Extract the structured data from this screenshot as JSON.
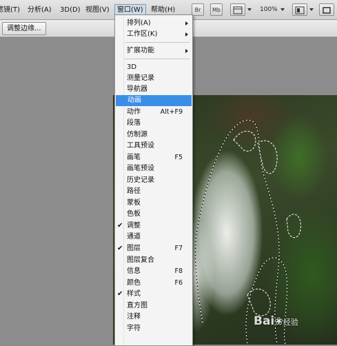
{
  "menubar": {
    "items": [
      {
        "label": "滤镜(T)"
      },
      {
        "label": "分析(A)"
      },
      {
        "label": "3D(D)"
      },
      {
        "label": "视图(V)"
      },
      {
        "label": "窗口(W)"
      },
      {
        "label": "帮助(H)"
      }
    ],
    "tools": {
      "br": "Br",
      "mb": "Mb"
    },
    "zoom": "100%"
  },
  "optbar": {
    "adjust_edge": "调整边缘..."
  },
  "window_menu": {
    "arrange": "排列(A)",
    "workspace": "工作区(K)",
    "extensions": "扩展功能",
    "items": [
      {
        "label": "3D"
      },
      {
        "label": "测量记录"
      },
      {
        "label": "导航器"
      },
      {
        "label": "动画"
      },
      {
        "label": "动作",
        "shortcut": "Alt+F9"
      },
      {
        "label": "段落"
      },
      {
        "label": "仿制源"
      },
      {
        "label": "工具预设"
      },
      {
        "label": "画笔",
        "shortcut": "F5"
      },
      {
        "label": "画笔预设"
      },
      {
        "label": "历史记录"
      },
      {
        "label": "路径"
      },
      {
        "label": "蒙板"
      },
      {
        "label": "色板"
      },
      {
        "label": "调整"
      },
      {
        "label": "通道"
      },
      {
        "label": "图层",
        "shortcut": "F7"
      },
      {
        "label": "图层复合"
      },
      {
        "label": "信息",
        "shortcut": "F8"
      },
      {
        "label": "颜色",
        "shortcut": "F6"
      },
      {
        "label": "样式"
      },
      {
        "label": "直方图"
      },
      {
        "label": "注释"
      },
      {
        "label": "字符"
      }
    ],
    "check_mark": "✔",
    "highlight_color": "#3a8ee6"
  },
  "watermark": {
    "text": "Bai",
    "paw": "❀",
    "suffix": "经验"
  }
}
